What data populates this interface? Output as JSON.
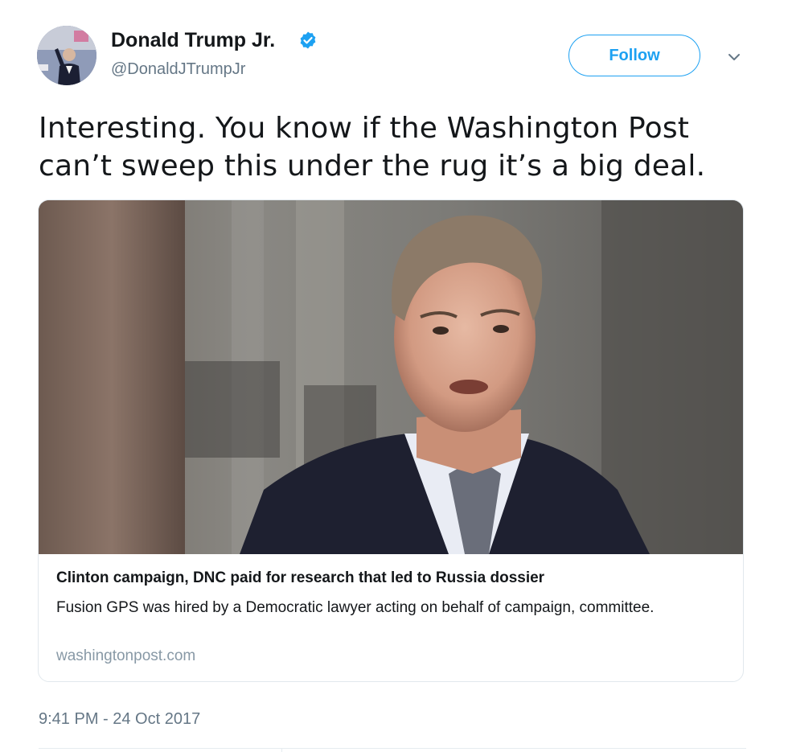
{
  "author": {
    "display_name": "Donald Trump Jr.",
    "handle": "@DonaldJTrumpJr",
    "verified_icon": "verified-badge-icon",
    "verified_color": "#1da1f2"
  },
  "actions": {
    "follow_label": "Follow",
    "more_icon": "chevron-down-icon"
  },
  "tweet": {
    "text": "Interesting. You know if the Washington Post can’t sweep this under the rug it’s a big deal.",
    "timestamp": "9:41 PM - 24 Oct 2017"
  },
  "card": {
    "title": "Clinton campaign, DNC paid for research that led to Russia dossier",
    "description": "Fusion GPS was hired by a Democratic lawyer acting on behalf of campaign, committee.",
    "domain": "washingtonpost.com"
  },
  "colors": {
    "accent": "#1da1f2",
    "text_primary": "#14171a",
    "text_secondary": "#657786",
    "border": "#e1e8ed"
  }
}
